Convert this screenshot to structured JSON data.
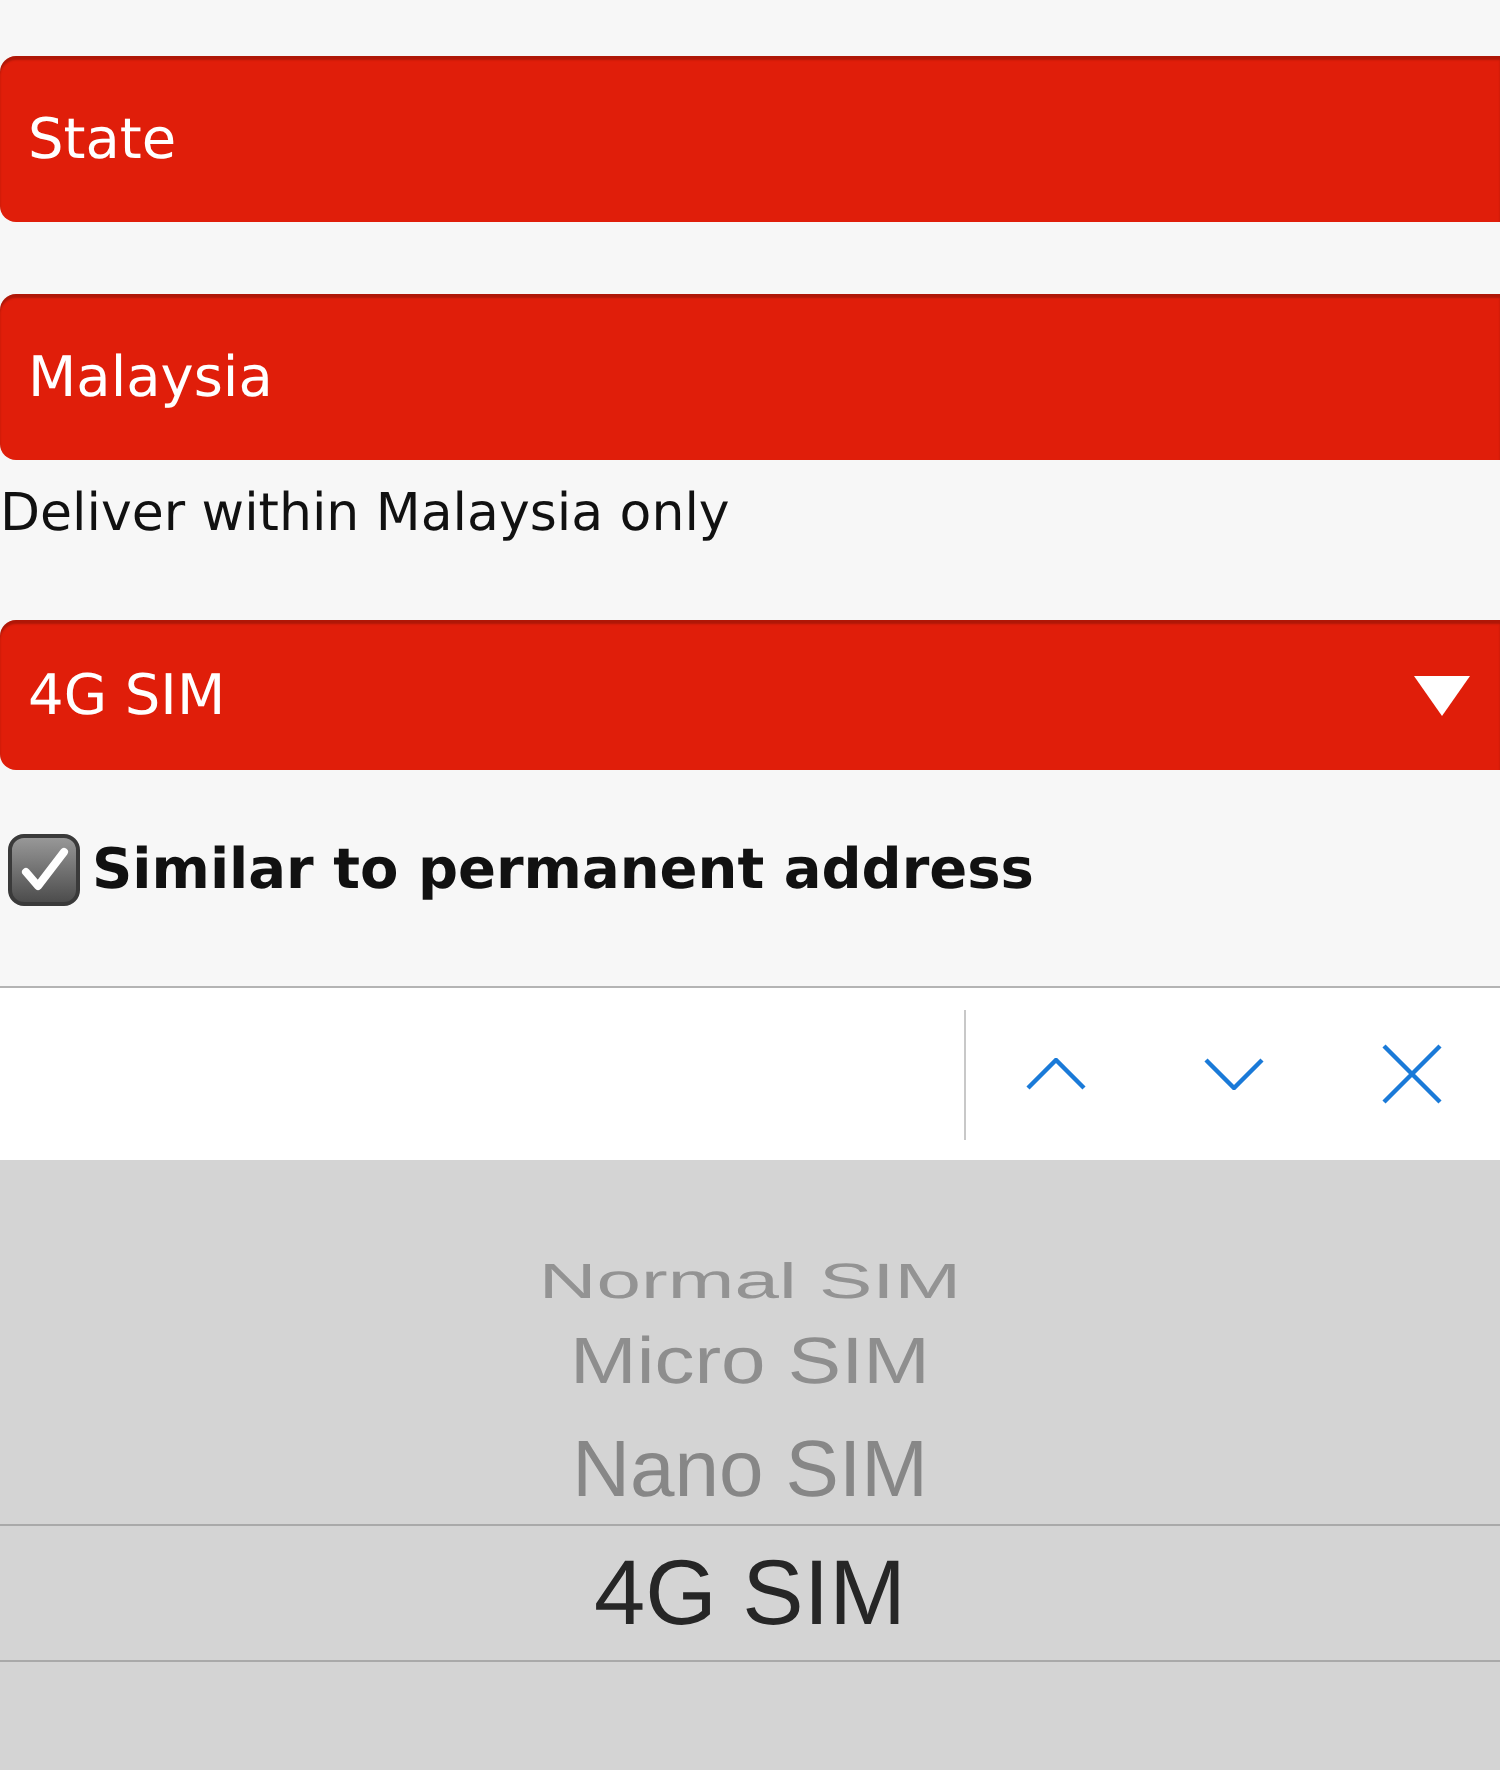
{
  "form": {
    "fields": [
      {
        "kind": "text",
        "value": "State"
      },
      {
        "kind": "text",
        "value": "Malaysia",
        "note": "Deliver within Malaysia only"
      },
      {
        "kind": "select",
        "value": "4G SIM"
      }
    ],
    "checkbox": {
      "label": "Similar to permanent address",
      "checked": true
    }
  },
  "picker": {
    "options": [
      {
        "label": "Normal SIM",
        "selected": false
      },
      {
        "label": "Micro SIM",
        "selected": false
      },
      {
        "label": "Nano SIM",
        "selected": false
      },
      {
        "label": "4G SIM",
        "selected": true
      }
    ]
  }
}
